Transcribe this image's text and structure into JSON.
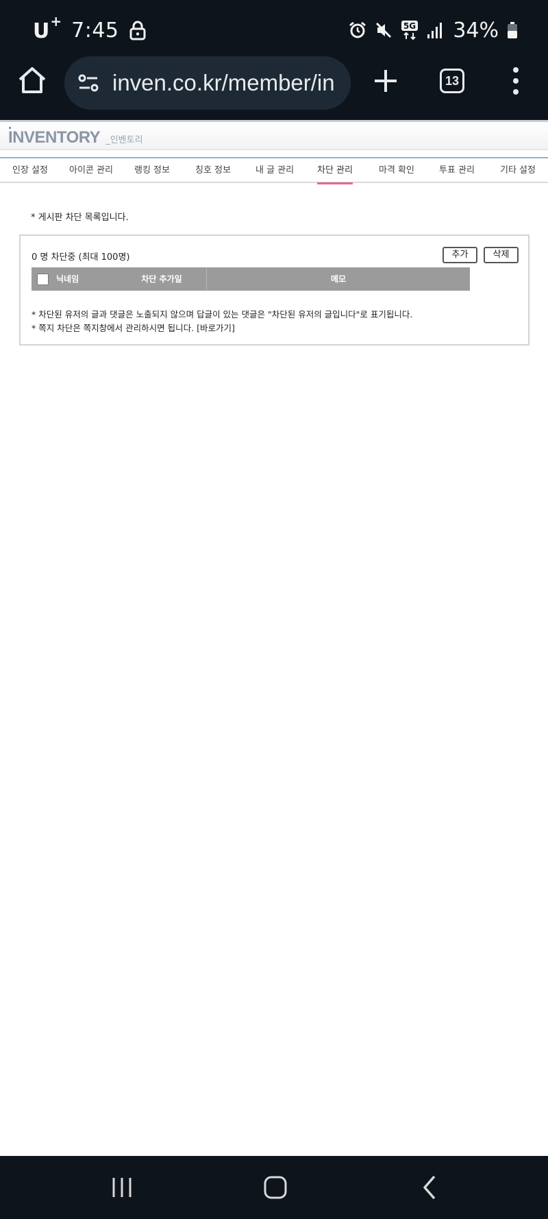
{
  "status_bar": {
    "carrier": "U",
    "carrier_plus": "+",
    "time": "7:45",
    "network": "5G",
    "battery": "34%"
  },
  "browser": {
    "url": "inven.co.kr/member/in",
    "tab_count": "13"
  },
  "header": {
    "logo": "INVENTORY",
    "logo_sub": "_인벤토리"
  },
  "tabs": [
    {
      "label": "인장 설정"
    },
    {
      "label": "아이콘 관리"
    },
    {
      "label": "랭킹 정보"
    },
    {
      "label": "칭호 정보"
    },
    {
      "label": "내 글 관리"
    },
    {
      "label": "차단 관리",
      "active": true
    },
    {
      "label": "마격 확인"
    },
    {
      "label": "투표 관리"
    },
    {
      "label": "기타 설정"
    }
  ],
  "content": {
    "intro": "* 게시판 차단 목록입니다.",
    "count_text": "0 명 차단중 (최대 100명)",
    "add_button": "추가",
    "delete_button": "삭제",
    "columns": {
      "nickname": "닉네임",
      "date": "차단 추가일",
      "memo": "메모"
    },
    "note1": "* 차단된 유저의 글과 댓글은 노출되지 않으며 답글이 있는 댓글은 \"차단된 유저의 글입니다\"로 표기됩니다.",
    "note2": "* 쪽지 차단은 쪽지창에서 관리하시면 됩니다. [바로가기]"
  },
  "colors": {
    "chrome_bg": "#0e141b",
    "url_pill": "#1d2a35",
    "table_header": "#9b9b9b",
    "active_tab_underline": "#e06b8b",
    "tab_border": "#8fb0d2"
  }
}
